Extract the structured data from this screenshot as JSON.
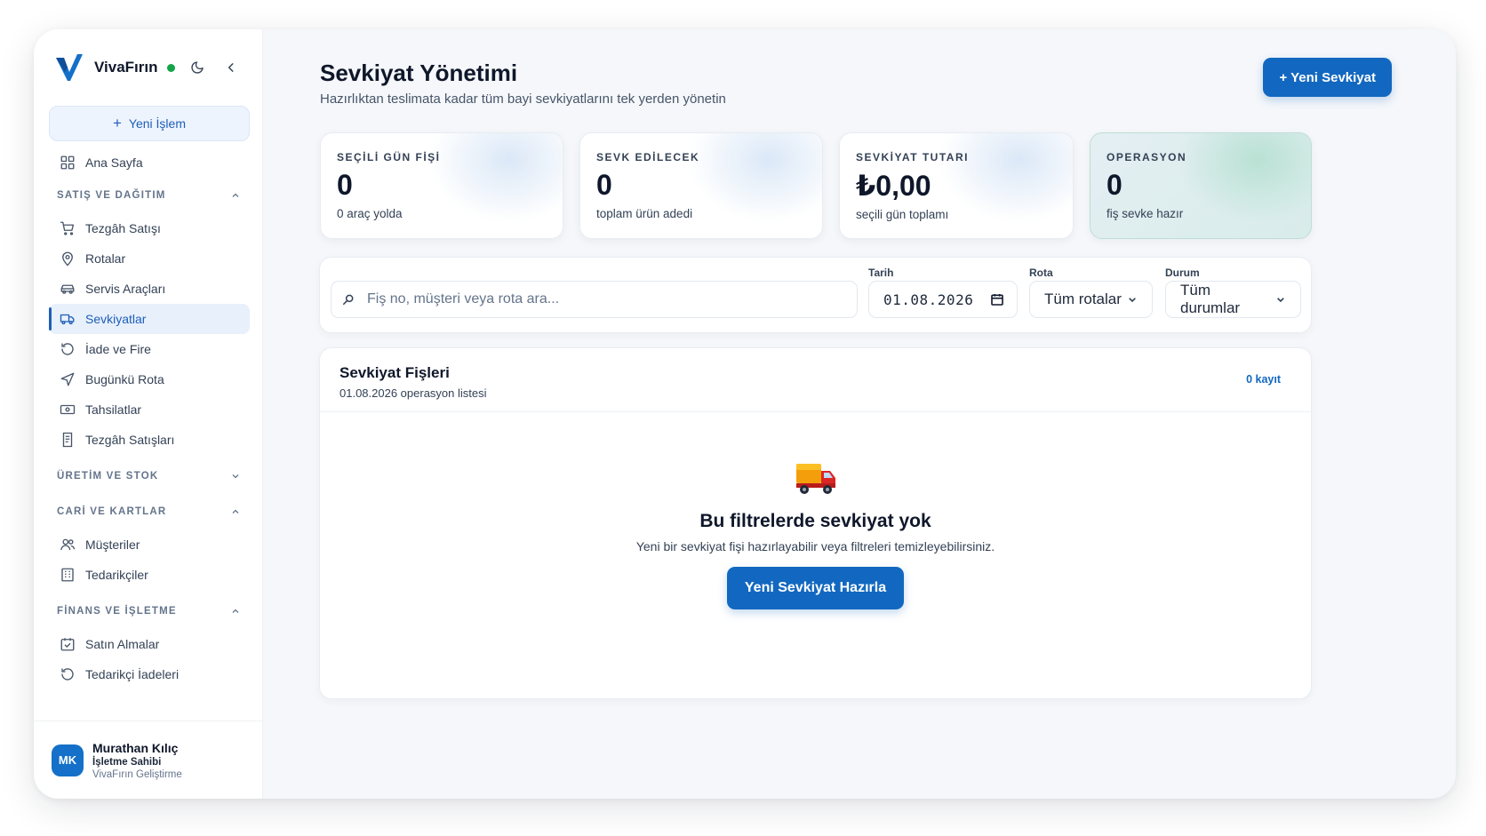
{
  "brand": {
    "name": "VivaFırın"
  },
  "sidebar": {
    "new_operation": "Yeni İşlem",
    "home": "Ana Sayfa",
    "sections": [
      {
        "title": "SATIŞ VE DAĞITIM",
        "items": [
          "Tezgâh Satışı",
          "Rotalar",
          "Servis Araçları",
          "Sevkiyatlar",
          "İade ve Fire",
          "Bugünkü Rota",
          "Tahsilatlar",
          "Tezgâh Satışları"
        ]
      },
      {
        "title": "ÜRETİM VE STOK",
        "items": []
      },
      {
        "title": "CARİ VE KARTLAR",
        "items": [
          "Müşteriler",
          "Tedarikçiler"
        ]
      },
      {
        "title": "FİNANS VE İŞLETME",
        "items": [
          "Satın Almalar",
          "Tedarikçi İadeleri"
        ]
      }
    ],
    "active_item": "Sevkiyatlar"
  },
  "user": {
    "initials": "MK",
    "name": "Murathan Kılıç",
    "role": "İşletme Sahibi",
    "company": "VivaFırın Geliştirme"
  },
  "header": {
    "title": "Sevkiyat Yönetimi",
    "subtitle": "Hazırlıktan teslimata kadar tüm bayi sevkiyatlarını tek yerden yönetin",
    "new_button": "+ Yeni Sevkiyat"
  },
  "stats": [
    {
      "label": "SEÇİLİ GÜN FİŞİ",
      "value": "0",
      "sub": "0 araç yolda"
    },
    {
      "label": "SEVK EDİLECEK",
      "value": "0",
      "sub": "toplam ürün adedi"
    },
    {
      "label": "SEVKİYAT TUTARI",
      "value": "₺0,00",
      "sub": "seçili gün toplamı"
    },
    {
      "label": "OPERASYON",
      "value": "0",
      "sub": "fiş sevke hazır"
    }
  ],
  "filters": {
    "search_placeholder": "Fiş no, müşteri veya rota ara...",
    "date_label": "Tarih",
    "date_value": "01.08.2026",
    "route_label": "Rota",
    "route_value": "Tüm rotalar",
    "status_label": "Durum",
    "status_value": "Tüm durumlar"
  },
  "list": {
    "title": "Sevkiyat Fişleri",
    "subtitle": "01.08.2026 operasyon listesi",
    "count": "0 kayıt",
    "empty_title": "Bu filtrelerde sevkiyat yok",
    "empty_sub": "Yeni bir sevkiyat fişi hazırlayabilir veya filtreleri temizleyebilirsiniz.",
    "empty_button": "Yeni Sevkiyat Hazırla"
  },
  "colors": {
    "primary": "#1268c0",
    "status_online": "#16a34a",
    "active_bg": "#e8f0fc"
  }
}
